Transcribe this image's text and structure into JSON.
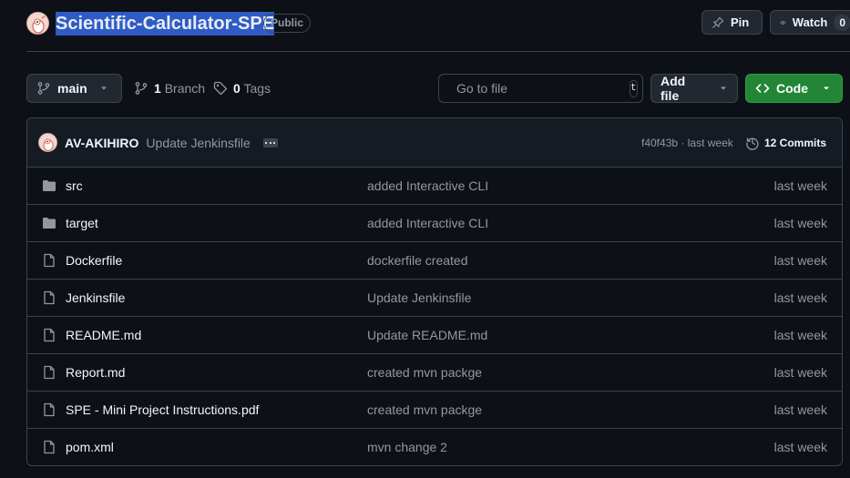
{
  "repo": {
    "name": "Scientific-Calculator-SPE",
    "visibility": "Public",
    "pin_label": "Pin",
    "watch_label": "Watch",
    "watch_count": "0"
  },
  "toolbar": {
    "branch": "main",
    "branch_count": "1",
    "branch_label": "Branch",
    "tag_count": "0",
    "tag_label": "Tags",
    "search_placeholder": "Go to file",
    "search_shortcut": "t",
    "add_file_label": "Add file",
    "code_label": "Code"
  },
  "latest_commit": {
    "author": "AV-AKIHIRO",
    "message": "Update Jenkinsfile",
    "hash": "f40f43b",
    "separator": "·",
    "time": "last week",
    "commits_label": "12 Commits"
  },
  "files": [
    {
      "type": "folder",
      "name": "src",
      "commit": "added Interactive CLI",
      "age": "last week"
    },
    {
      "type": "folder",
      "name": "target",
      "commit": "added Interactive CLI",
      "age": "last week"
    },
    {
      "type": "file",
      "name": "Dockerfile",
      "commit": "dockerfile created",
      "age": "last week"
    },
    {
      "type": "file",
      "name": "Jenkinsfile",
      "commit": "Update Jenkinsfile",
      "age": "last week"
    },
    {
      "type": "file",
      "name": "README.md",
      "commit": "Update README.md",
      "age": "last week"
    },
    {
      "type": "file",
      "name": "Report.md",
      "commit": "created mvn packge",
      "age": "last week"
    },
    {
      "type": "file",
      "name": "SPE - Mini Project Instructions.pdf",
      "commit": "created mvn packge",
      "age": "last week"
    },
    {
      "type": "file",
      "name": "pom.xml",
      "commit": "mvn change 2",
      "age": "last week"
    }
  ],
  "colors": {
    "background": "#0d1117",
    "border": "#3d444d",
    "muted_text": "#9198a1",
    "primary_button": "#238636",
    "selection": "#2f5bc5"
  }
}
